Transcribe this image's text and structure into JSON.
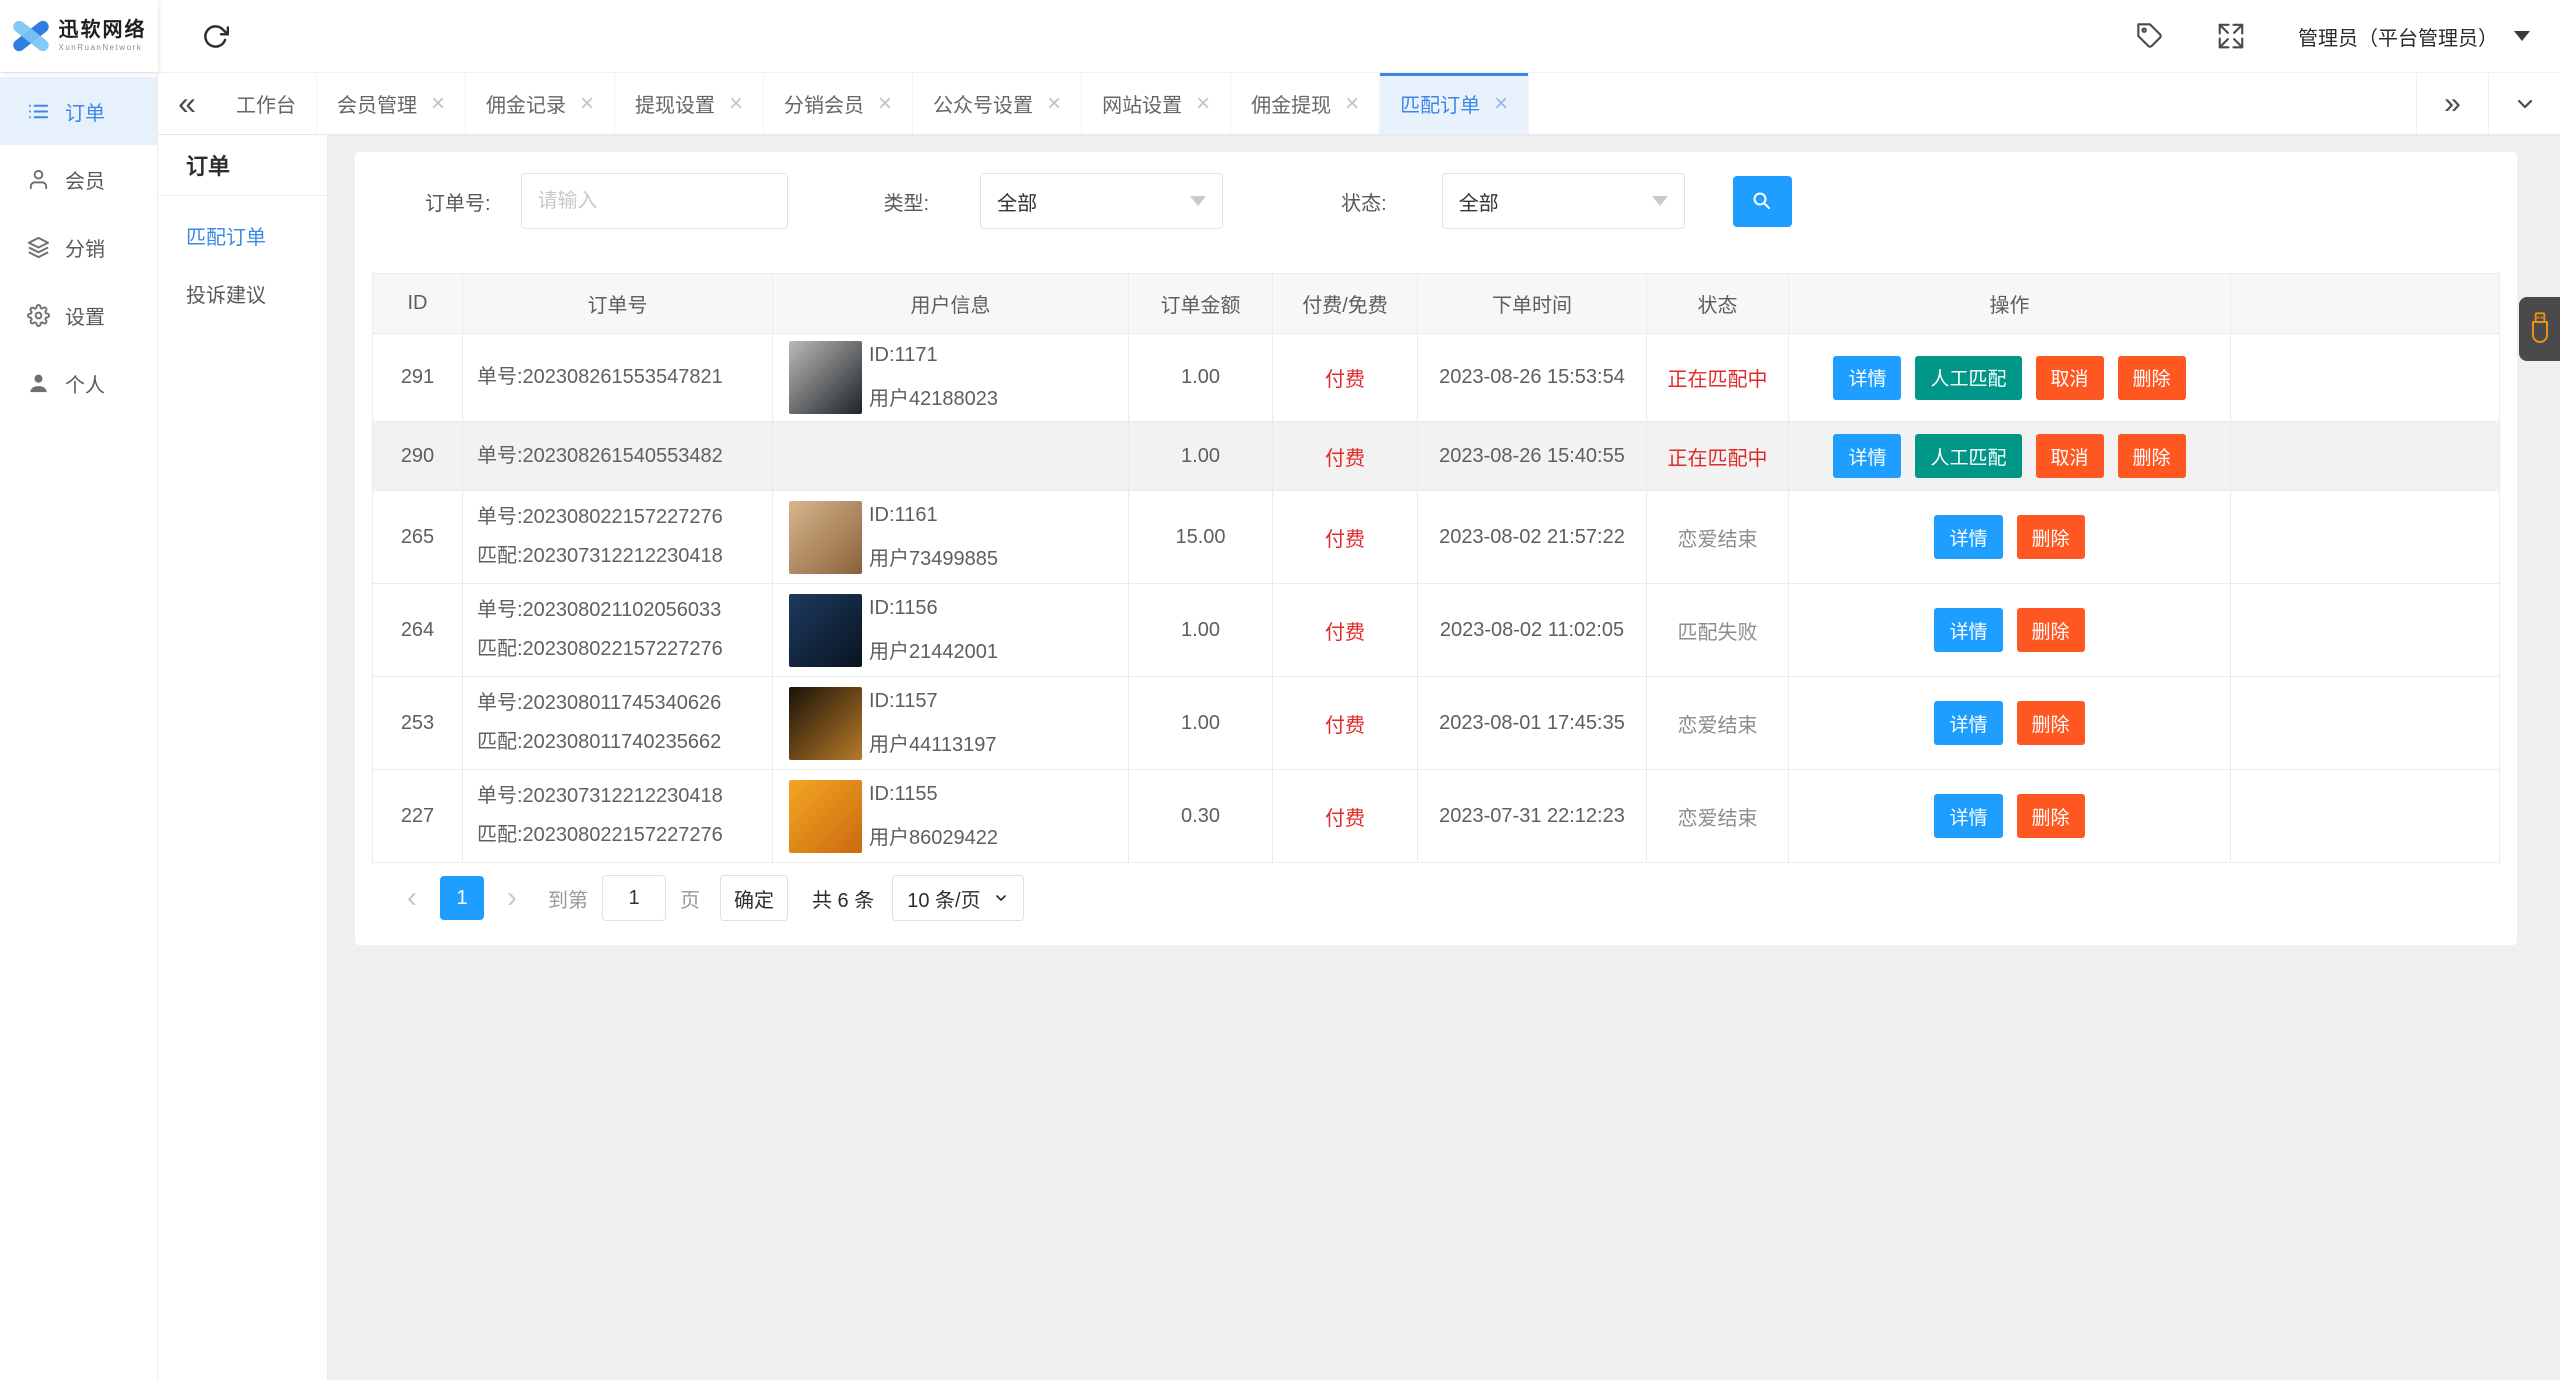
{
  "app": {
    "logo_text": "迅软网络",
    "logo_subtext": "XunRuanNetwork",
    "admin_label": "管理员（平台管理员）"
  },
  "sidebar": {
    "items": [
      {
        "key": "order",
        "label": "订单",
        "icon": "order-list-icon",
        "active": true
      },
      {
        "key": "member",
        "label": "会员",
        "icon": "member-icon",
        "active": false
      },
      {
        "key": "distribution",
        "label": "分销",
        "icon": "distribution-icon",
        "active": false
      },
      {
        "key": "settings",
        "label": "设置",
        "icon": "settings-icon",
        "active": false
      },
      {
        "key": "profile",
        "label": "个人",
        "icon": "profile-icon",
        "active": false
      }
    ]
  },
  "tabs": {
    "items": [
      {
        "key": "workbench",
        "label": "工作台",
        "closable": false,
        "active": false
      },
      {
        "key": "member-manage",
        "label": "会员管理",
        "closable": true,
        "active": false
      },
      {
        "key": "commission-record",
        "label": "佣金记录",
        "closable": true,
        "active": false
      },
      {
        "key": "withdraw-settings",
        "label": "提现设置",
        "closable": true,
        "active": false
      },
      {
        "key": "distribution-member",
        "label": "分销会员",
        "closable": true,
        "active": false
      },
      {
        "key": "official-account-settings",
        "label": "公众号设置",
        "closable": true,
        "active": false
      },
      {
        "key": "website-settings",
        "label": "网站设置",
        "closable": true,
        "active": false
      },
      {
        "key": "commission-withdraw",
        "label": "佣金提现",
        "closable": true,
        "active": false
      },
      {
        "key": "match-order",
        "label": "匹配订单",
        "closable": true,
        "active": true
      }
    ]
  },
  "submenu": {
    "title": "订单",
    "items": [
      {
        "key": "match-order",
        "label": "匹配订单",
        "active": true
      },
      {
        "key": "complaint-suggestion",
        "label": "投诉建议",
        "active": false
      }
    ]
  },
  "filters": {
    "order_no_label": "订单号:",
    "order_no_placeholder": "请输入",
    "type_label": "类型:",
    "type_value": "全部",
    "status_label": "状态:",
    "status_value": "全部"
  },
  "table": {
    "columns": [
      "ID",
      "订单号",
      "用户信息",
      "订单金额",
      "付费/免费",
      "下单时间",
      "状态",
      "操作"
    ],
    "rows": [
      {
        "id": "291",
        "order_lines": [
          "单号:202308261553547821"
        ],
        "user": {
          "id": "ID:1171",
          "name": "用户42188023",
          "avatar_colors": [
            "#b9b9b9",
            "#1f2327"
          ]
        },
        "amount": "1.00",
        "fee": "付费",
        "time": "2023-08-26 15:53:54",
        "status": "正在匹配中",
        "status_type": "danger",
        "highlighted": false,
        "actions": [
          {
            "name": "detail-button",
            "label": "详情",
            "color": "#1E9FFF"
          },
          {
            "name": "manual-match-button",
            "label": "人工匹配",
            "color": "#009688"
          },
          {
            "name": "cancel-button",
            "label": "取消",
            "color": "#FF5722"
          },
          {
            "name": "delete-button",
            "label": "删除",
            "color": "#FF5722"
          }
        ]
      },
      {
        "id": "290",
        "order_lines": [
          "单号:202308261540553482"
        ],
        "user": null,
        "amount": "1.00",
        "fee": "付费",
        "time": "2023-08-26 15:40:55",
        "status": "正在匹配中",
        "status_type": "danger",
        "highlighted": true,
        "actions": [
          {
            "name": "detail-button",
            "label": "详情",
            "color": "#1E9FFF"
          },
          {
            "name": "manual-match-button",
            "label": "人工匹配",
            "color": "#009688"
          },
          {
            "name": "cancel-button",
            "label": "取消",
            "color": "#FF5722"
          },
          {
            "name": "delete-button",
            "label": "删除",
            "color": "#FF5722"
          }
        ]
      },
      {
        "id": "265",
        "order_lines": [
          "单号:202308022157227276",
          "匹配:202307312212230418"
        ],
        "user": {
          "id": "ID:1161",
          "name": "用户73499885",
          "avatar_colors": [
            "#d8b78e",
            "#8a6138"
          ]
        },
        "amount": "15.00",
        "fee": "付费",
        "time": "2023-08-02 21:57:22",
        "status": "恋爱结束",
        "status_type": "muted",
        "highlighted": false,
        "actions": [
          {
            "name": "detail-button",
            "label": "详情",
            "color": "#1E9FFF"
          },
          {
            "name": "delete-button",
            "label": "删除",
            "color": "#FF5722"
          }
        ]
      },
      {
        "id": "264",
        "order_lines": [
          "单号:202308021102056033",
          "匹配:202308022157227276"
        ],
        "user": {
          "id": "ID:1156",
          "name": "用户21442001",
          "avatar_colors": [
            "#1d3a5f",
            "#0a1420"
          ]
        },
        "amount": "1.00",
        "fee": "付费",
        "time": "2023-08-02 11:02:05",
        "status": "匹配失败",
        "status_type": "muted",
        "highlighted": false,
        "actions": [
          {
            "name": "detail-button",
            "label": "详情",
            "color": "#1E9FFF"
          },
          {
            "name": "delete-button",
            "label": "删除",
            "color": "#FF5722"
          }
        ]
      },
      {
        "id": "253",
        "order_lines": [
          "单号:202308011745340626",
          "匹配:202308011740235662"
        ],
        "user": {
          "id": "ID:1157",
          "name": "用户44113197",
          "avatar_colors": [
            "#1a1208",
            "#b97a2a"
          ]
        },
        "amount": "1.00",
        "fee": "付费",
        "time": "2023-08-01 17:45:35",
        "status": "恋爱结束",
        "status_type": "muted",
        "highlighted": false,
        "actions": [
          {
            "name": "detail-button",
            "label": "详情",
            "color": "#1E9FFF"
          },
          {
            "name": "delete-button",
            "label": "删除",
            "color": "#FF5722"
          }
        ]
      },
      {
        "id": "227",
        "order_lines": [
          "单号:202307312212230418",
          "匹配:202308022157227276"
        ],
        "user": {
          "id": "ID:1155",
          "name": "用户86029422",
          "avatar_colors": [
            "#f5a623",
            "#c96a10"
          ]
        },
        "amount": "0.30",
        "fee": "付费",
        "time": "2023-07-31 22:12:23",
        "status": "恋爱结束",
        "status_type": "muted",
        "highlighted": false,
        "actions": [
          {
            "name": "detail-button",
            "label": "详情",
            "color": "#1E9FFF"
          },
          {
            "name": "delete-button",
            "label": "删除",
            "color": "#FF5722"
          }
        ]
      }
    ]
  },
  "pagination": {
    "current_page": "1",
    "goto_label": "到第",
    "goto_value": "1",
    "page_label": "页",
    "confirm_label": "确定",
    "total_label": "共 6 条",
    "page_size": "10 条/页"
  },
  "floating_widget": {
    "icon": "usb-icon",
    "icon_color": "#ef9118"
  },
  "colors": {
    "accent": "#1E9FFF",
    "nav_blue": "#3d87e8",
    "teal": "#009688",
    "orange": "#FF5722",
    "danger_text": "#e02b2b",
    "muted_text": "#8c8c8c"
  }
}
